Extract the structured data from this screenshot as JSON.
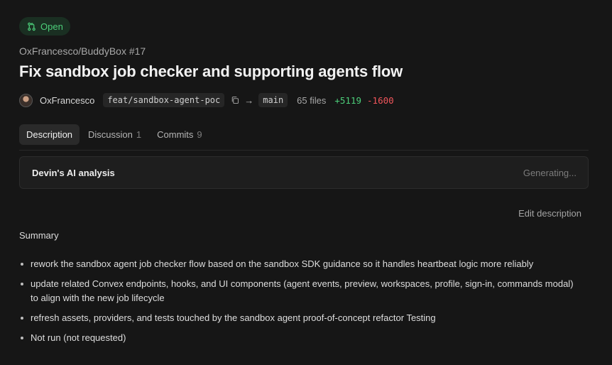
{
  "status": {
    "label": "Open",
    "icon": "git-pull-request-icon",
    "color": "#4ccf7a"
  },
  "pr": {
    "repo_ref": "OxFrancesco/BuddyBox #17",
    "title": "Fix sandbox job checker and supporting agents flow",
    "author": "OxFrancesco",
    "source_branch": "feat/sandbox-agent-poc",
    "arrow": "→",
    "target_branch": "main",
    "files_changed": "65 files",
    "additions": "+5119",
    "deletions": "-1600"
  },
  "tabs": [
    {
      "label": "Description",
      "count": "",
      "active": true
    },
    {
      "label": "Discussion",
      "count": "1",
      "active": false
    },
    {
      "label": "Commits",
      "count": "9",
      "active": false
    }
  ],
  "ai_analysis": {
    "title": "Devin's AI analysis",
    "status": "Generating..."
  },
  "edit_description_label": "Edit description",
  "summary": {
    "heading": "Summary",
    "items": [
      "rework the sandbox agent job checker flow based on the sandbox SDK guidance so it handles heartbeat logic more reliably",
      "update related Convex endpoints, hooks, and UI components (agent events, preview, workspaces, profile, sign-in, commands modal) to align with the new job lifecycle",
      "refresh assets, providers, and tests touched by the sandbox agent proof-of-concept refactor Testing",
      "Not run (not requested)"
    ]
  },
  "colors": {
    "background": "#161616",
    "success": "#4ccf7a",
    "danger": "#f0555b"
  }
}
